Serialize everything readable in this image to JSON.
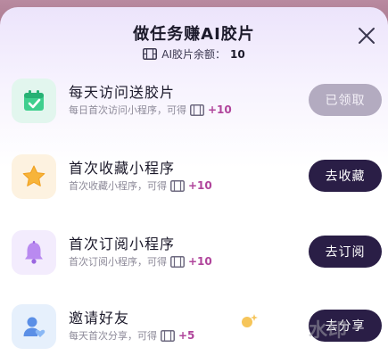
{
  "header": {
    "title": "做任务赚AI胶片",
    "balance_label": "AI胶片余额：",
    "balance_value": "10"
  },
  "tasks": [
    {
      "name": "每天访问送胶片",
      "desc": "每日首次访问小程序，可得",
      "reward": "+10",
      "button": "已领取",
      "button_state": "claimed",
      "icon": "calendar-check-icon",
      "tile_color": "#e2f6ee"
    },
    {
      "name": "首次收藏小程序",
      "desc": "首次收藏小程序，可得",
      "reward": "+10",
      "button": "去收藏",
      "button_state": "available",
      "icon": "star-icon",
      "tile_color": "#fdf2e0"
    },
    {
      "name": "首次订阅小程序",
      "desc": "首次订阅小程序，可得",
      "reward": "+10",
      "button": "去订阅",
      "button_state": "available",
      "icon": "bell-icon",
      "tile_color": "#f3ecfd"
    },
    {
      "name": "邀请好友",
      "desc": "每天首次分享，可得",
      "reward": "+5",
      "button": "去分享",
      "button_state": "available",
      "icon": "user-heart-icon",
      "tile_color": "#e6f0fc"
    }
  ],
  "watermark": "水印",
  "colors": {
    "accent": "#2a1e46",
    "reward": "#b0449b",
    "claimed_button": "#b3abc0"
  }
}
